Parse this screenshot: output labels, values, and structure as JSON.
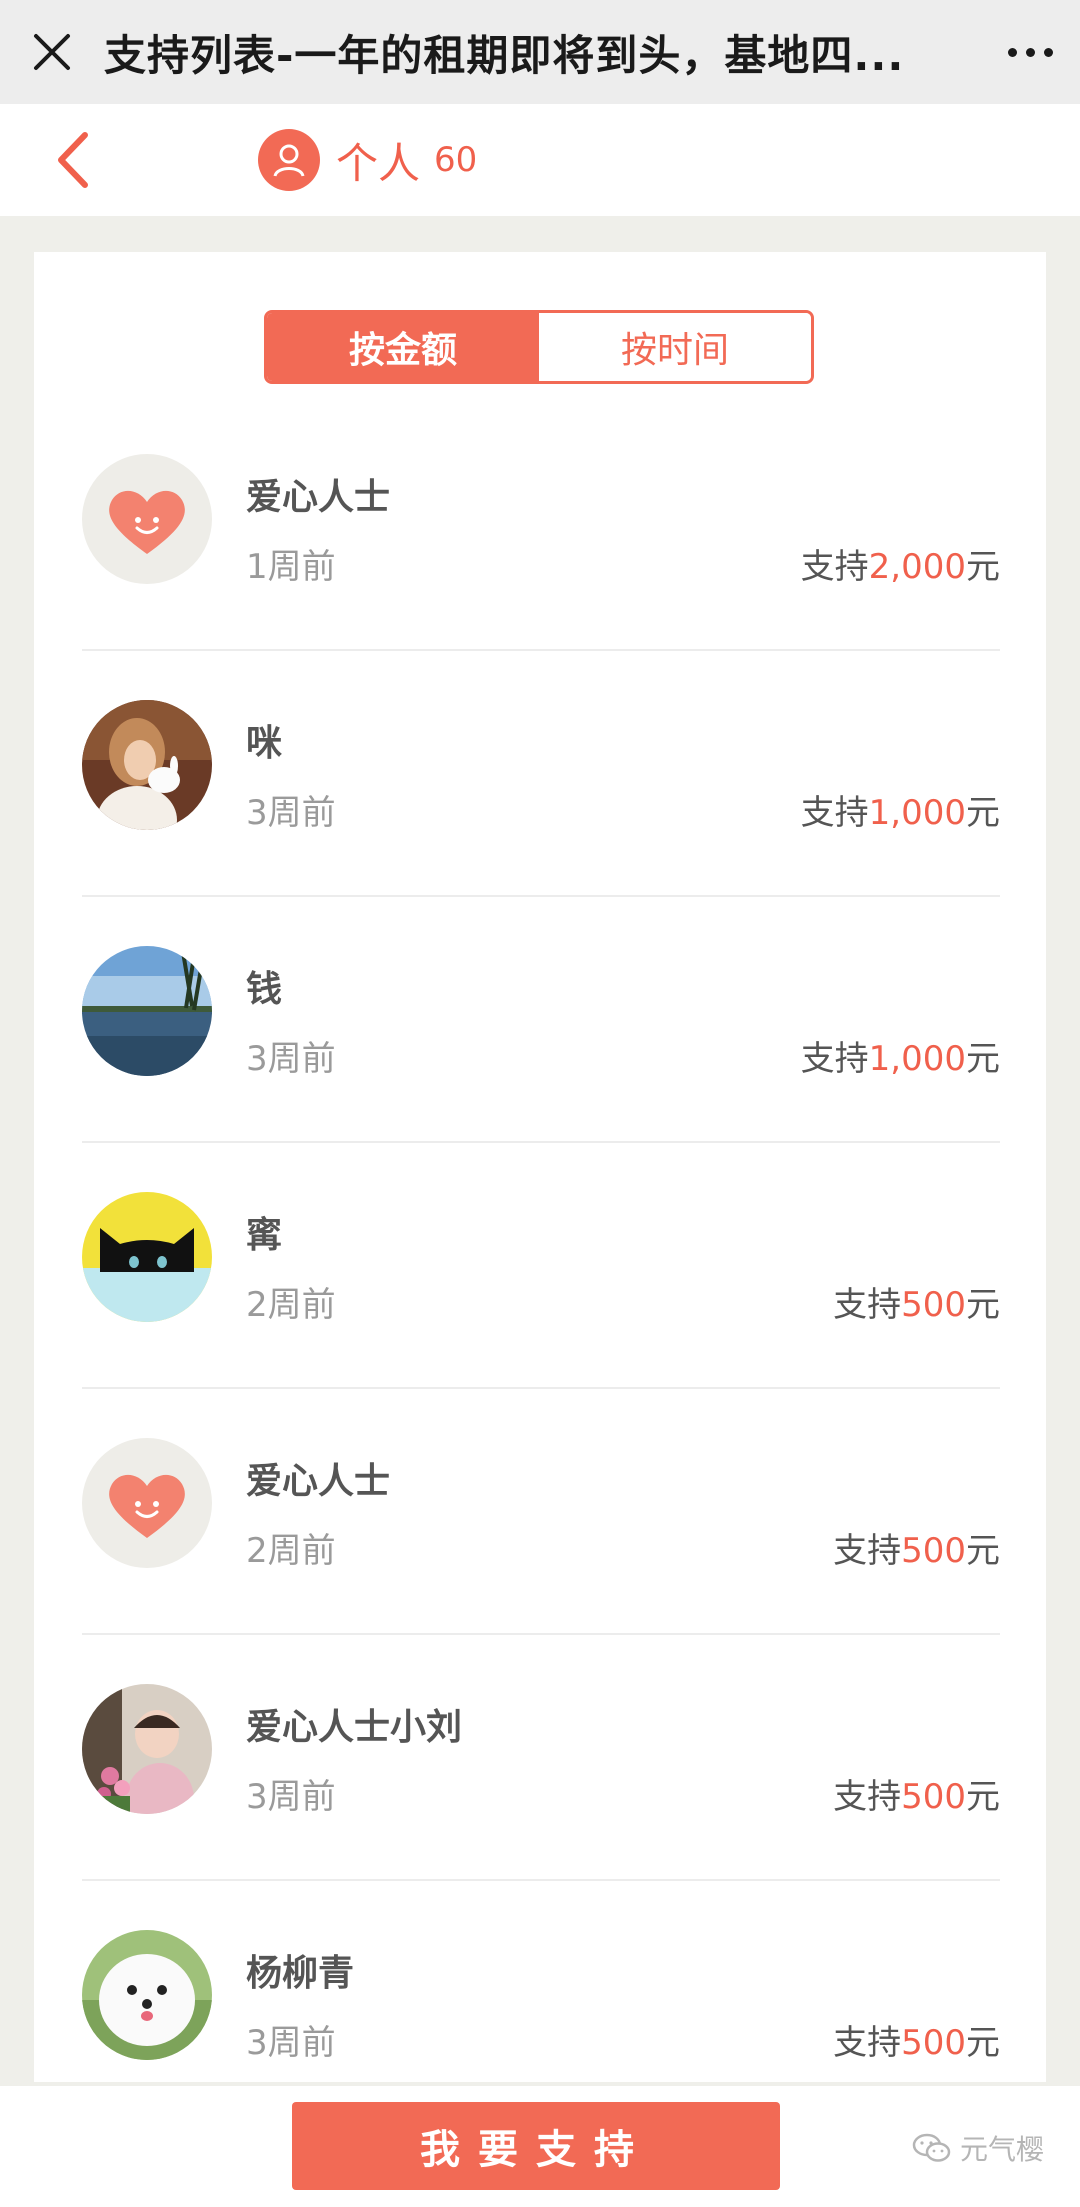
{
  "titlebar": {
    "title": "支持列表-一年的租期即将到头，基地四..."
  },
  "header": {
    "label": "个人",
    "count": "60"
  },
  "tabs": [
    {
      "label": "按金额",
      "active": true
    },
    {
      "label": "按时间",
      "active": false
    }
  ],
  "support_prefix": "支持",
  "support_suffix": "元",
  "supporters": [
    {
      "name": "爱心人士",
      "time": "1周前",
      "amount": "2,000",
      "avatar": "heart-avatar"
    },
    {
      "name": "咪",
      "time": "3周前",
      "amount": "1,000",
      "avatar": "girl-bunny-photo"
    },
    {
      "name": "钱",
      "time": "3周前",
      "amount": "1,000",
      "avatar": "lake-photo"
    },
    {
      "name": "寗",
      "time": "2周前",
      "amount": "500",
      "avatar": "black-cat-avatar"
    },
    {
      "name": "爱心人士",
      "time": "2周前",
      "amount": "500",
      "avatar": "heart-avatar"
    },
    {
      "name": "爱心人士小刘",
      "time": "3周前",
      "amount": "500",
      "avatar": "child-flowers-photo"
    },
    {
      "name": "杨柳青",
      "time": "3周前",
      "amount": "500",
      "avatar": "white-dog-photo"
    }
  ],
  "bottom": {
    "button_label": "我要支持",
    "watermark": "元气樱"
  },
  "colors": {
    "accent": "#f26a55",
    "title_bar": "#ededed",
    "page_bg": "#efefea"
  }
}
